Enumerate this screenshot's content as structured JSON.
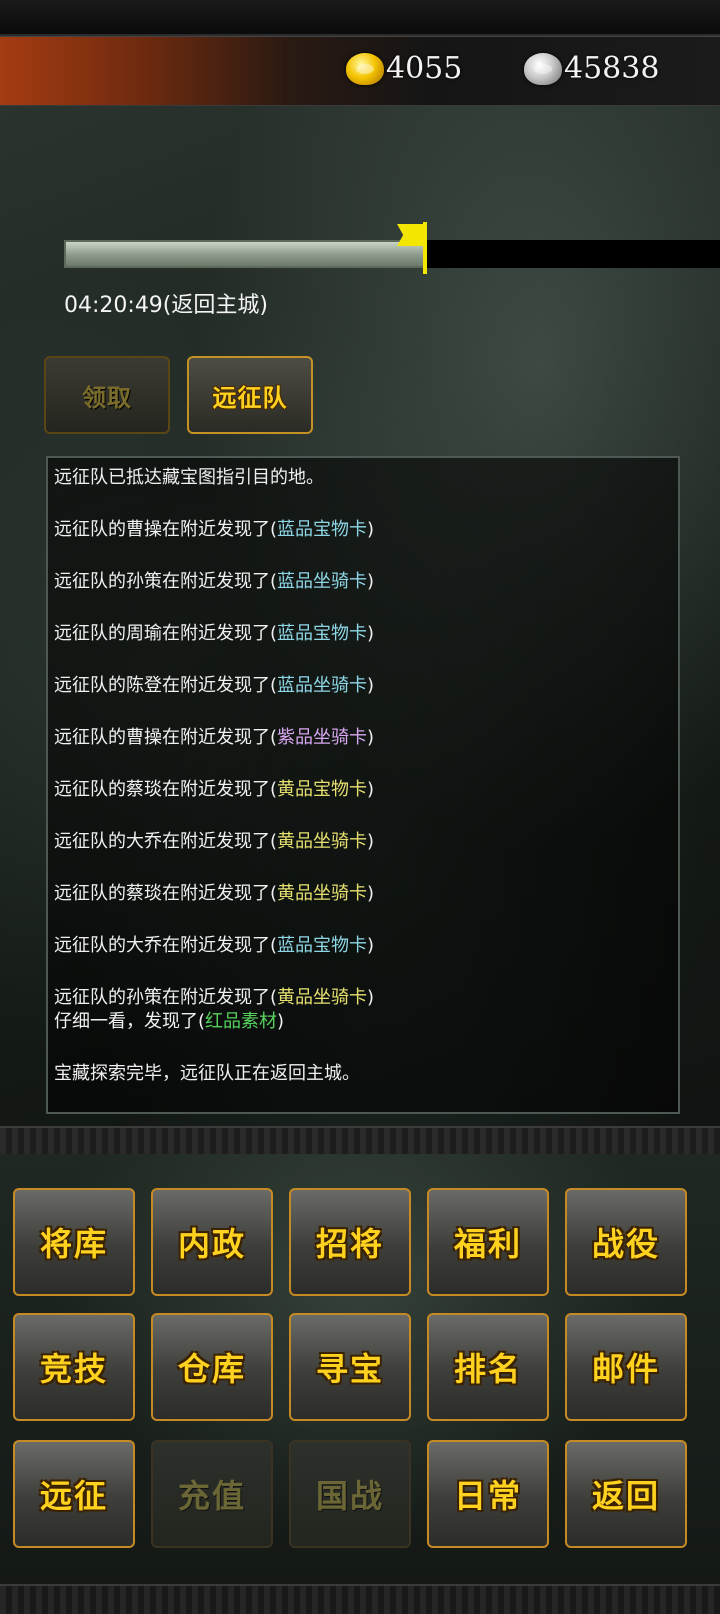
{
  "header": {
    "gold_icon": "gold-ingot-icon",
    "gold_amount": "4055",
    "silver_icon": "silver-ingot-icon",
    "silver_amount": "45838"
  },
  "progress": {
    "fraction": 0.55,
    "timer_text": "04:20:49(返回主城)"
  },
  "actions": {
    "claim_label": "领取",
    "expedition_label": "远征队"
  },
  "log": [
    {
      "text": "远征队已抵达藏宝图指引目的地。"
    },
    {
      "prefix": "远征队的曹操在附近发现了(",
      "item": "蓝品宝物卡",
      "suffix": ")",
      "color": "blue"
    },
    {
      "prefix": "远征队的孙策在附近发现了(",
      "item": "蓝品坐骑卡",
      "suffix": ")",
      "color": "blue"
    },
    {
      "prefix": "远征队的周瑜在附近发现了(",
      "item": "蓝品宝物卡",
      "suffix": ")",
      "color": "blue"
    },
    {
      "prefix": "远征队的陈登在附近发现了(",
      "item": "蓝品坐骑卡",
      "suffix": ")",
      "color": "blue"
    },
    {
      "prefix": "远征队的曹操在附近发现了(",
      "item": "紫品坐骑卡",
      "suffix": ")",
      "color": "purple"
    },
    {
      "prefix": "远征队的蔡琰在附近发现了(",
      "item": "黄品宝物卡",
      "suffix": ")",
      "color": "yellow"
    },
    {
      "prefix": "远征队的大乔在附近发现了(",
      "item": "黄品坐骑卡",
      "suffix": ")",
      "color": "yellow"
    },
    {
      "prefix": "远征队的蔡琰在附近发现了(",
      "item": "黄品坐骑卡",
      "suffix": ")",
      "color": "yellow"
    },
    {
      "prefix": "远征队的大乔在附近发现了(",
      "item": "蓝品宝物卡",
      "suffix": ")",
      "color": "blue"
    },
    {
      "prefix": "远征队的孙策在附近发现了(",
      "item": "黄品坐骑卡",
      "suffix": ")",
      "color": "yellow",
      "tight": true
    },
    {
      "prefix": "仔细一看，发现了(",
      "item": "红品素材",
      "suffix": ")",
      "color": "red"
    },
    {
      "text": "宝藏探索完毕，远征队正在返回主城。"
    }
  ],
  "menu": [
    {
      "label": "将库",
      "enabled": true
    },
    {
      "label": "内政",
      "enabled": true
    },
    {
      "label": "招将",
      "enabled": true
    },
    {
      "label": "福利",
      "enabled": true
    },
    {
      "label": "战役",
      "enabled": true
    },
    {
      "label": "竞技",
      "enabled": true
    },
    {
      "label": "仓库",
      "enabled": true
    },
    {
      "label": "寻宝",
      "enabled": true
    },
    {
      "label": "排名",
      "enabled": true
    },
    {
      "label": "邮件",
      "enabled": true
    },
    {
      "label": "远征",
      "enabled": true
    },
    {
      "label": "充值",
      "enabled": false
    },
    {
      "label": "国战",
      "enabled": false
    },
    {
      "label": "日常",
      "enabled": true
    },
    {
      "label": "返回",
      "enabled": true
    }
  ],
  "colors": {
    "blue": "#8fd7e7",
    "purple": "#d7a6f0",
    "yellow": "#e6e070",
    "red": "#56d15d",
    "button_text": "#ffd21f"
  }
}
